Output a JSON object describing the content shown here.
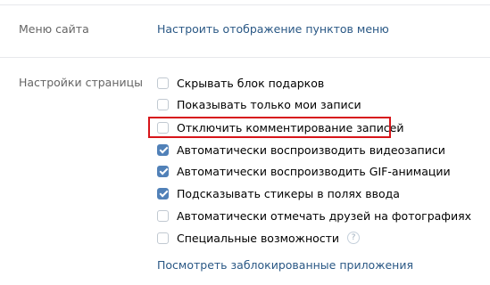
{
  "menu_section": {
    "label": "Меню сайта",
    "link": "Настроить отображение пунктов меню"
  },
  "page_settings": {
    "label": "Настройки страницы",
    "options": [
      {
        "label": "Скрывать блок подарков",
        "checked": false
      },
      {
        "label": "Показывать только мои записи",
        "checked": false
      },
      {
        "label": "Отключить комментирование записей",
        "checked": false,
        "highlighted": true
      },
      {
        "label": "Автоматически воспроизводить видеозаписи",
        "checked": true
      },
      {
        "label": "Автоматически воспроизводить GIF-анимации",
        "checked": true
      },
      {
        "label": "Подсказывать стикеры в полях ввода",
        "checked": true
      },
      {
        "label": "Автоматически отмечать друзей на фотографиях",
        "checked": false
      },
      {
        "label": "Специальные возможности",
        "checked": false,
        "help_icon": "question-mark-icon"
      }
    ],
    "help_glyph": "?",
    "blocked_apps_link": "Посмотреть заблокированные приложения"
  },
  "colors": {
    "accent": "#5181b8",
    "link": "#2a5885",
    "highlight_frame": "#d7151a",
    "label_gray": "#656565"
  }
}
